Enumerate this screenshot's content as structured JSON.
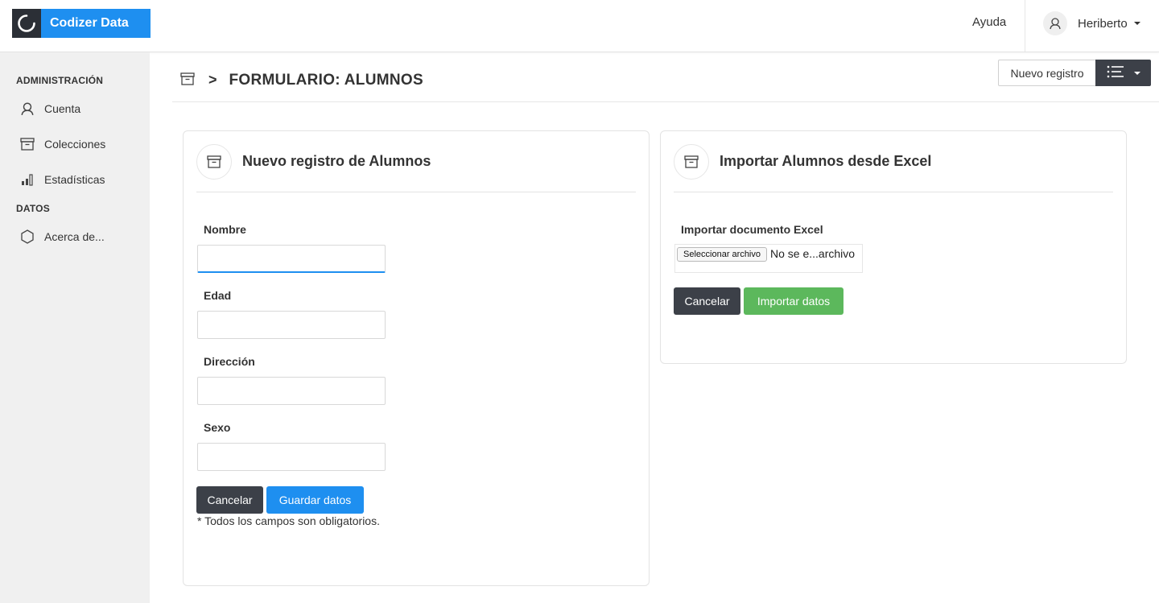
{
  "brand": {
    "name": "Codizer Data",
    "accent": "#1e8ff0",
    "dark": "#2b2f36"
  },
  "topbar": {
    "help_label": "Ayuda",
    "user_name": "Heriberto",
    "user_icon": "user-icon"
  },
  "sidebar": {
    "sections": [
      {
        "title": "ADMINISTRACIÓN"
      },
      {
        "title": "DATOS"
      }
    ],
    "items": [
      {
        "label": "Cuenta",
        "icon": "user-icon"
      },
      {
        "label": "Colecciones",
        "icon": "archive-icon"
      },
      {
        "label": "Estadísticas",
        "icon": "bar-chart-icon"
      },
      {
        "label": "Acerca de...",
        "icon": "hexagon-icon"
      }
    ]
  },
  "header": {
    "separator": ">",
    "title": "FORMULARIO: ALUMNOS",
    "new_record_label": "Nuevo registro"
  },
  "form_card": {
    "title": "Nuevo registro de Alumnos",
    "fields": [
      {
        "label": "Nombre",
        "value": ""
      },
      {
        "label": "Edad",
        "value": ""
      },
      {
        "label": "Dirección",
        "value": ""
      },
      {
        "label": "Sexo",
        "value": ""
      }
    ],
    "cancel_label": "Cancelar",
    "save_label": "Guardar datos",
    "note": "* Todos los campos son obligatorios."
  },
  "import_card": {
    "title": "Importar Alumnos desde Excel",
    "field_label": "Importar documento Excel",
    "file_button_label": "Seleccionar archivo",
    "file_status": "No se e...archivo",
    "cancel_label": "Cancelar",
    "import_label": "Importar datos"
  },
  "colors": {
    "dark_button": "#3c4048",
    "primary": "#1e8ff0",
    "success": "#5cb85c",
    "sidebar_bg": "#f0f0f0"
  }
}
